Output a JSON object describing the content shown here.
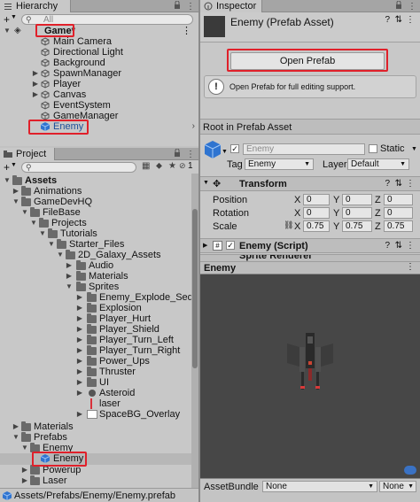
{
  "hierarchy": {
    "tab_label": "Hierarchy",
    "search_placeholder": "All",
    "add_button": "+",
    "items": [
      {
        "label": "Game*"
      },
      {
        "label": "Main Camera"
      },
      {
        "label": "Directional Light"
      },
      {
        "label": "Background"
      },
      {
        "label": "SpawnManager"
      },
      {
        "label": "Player"
      },
      {
        "label": "Canvas"
      },
      {
        "label": "EventSystem"
      },
      {
        "label": "GameManager"
      },
      {
        "label": "Enemy"
      }
    ]
  },
  "project": {
    "tab_label": "Project",
    "add_button": "+",
    "hidden_count": "1",
    "tree": [
      {
        "label": "Assets"
      },
      {
        "label": "Animations"
      },
      {
        "label": "GameDevHQ"
      },
      {
        "label": "FileBase"
      },
      {
        "label": "Projects"
      },
      {
        "label": "Tutorials"
      },
      {
        "label": "Starter_Files"
      },
      {
        "label": "2D_Galaxy_Assets"
      },
      {
        "label": "Audio"
      },
      {
        "label": "Materials"
      },
      {
        "label": "Sprites"
      },
      {
        "label": "Enemy_Explode_Sequen"
      },
      {
        "label": "Explosion"
      },
      {
        "label": "Player_Hurt"
      },
      {
        "label": "Player_Shield"
      },
      {
        "label": "Player_Turn_Left"
      },
      {
        "label": "Player_Turn_Right"
      },
      {
        "label": "Power_Ups"
      },
      {
        "label": "Thruster"
      },
      {
        "label": "UI"
      },
      {
        "label": "Asteroid"
      },
      {
        "label": "laser"
      },
      {
        "label": "SpaceBG_Overlay"
      },
      {
        "label": "Materials"
      },
      {
        "label": "Prefabs"
      },
      {
        "label": "Enemy"
      },
      {
        "label": "Enemy"
      },
      {
        "label": "Powerup"
      },
      {
        "label": "Laser"
      }
    ],
    "path": "Assets/Prefabs/Enemy/Enemy.prefab"
  },
  "inspector": {
    "tab_label": "Inspector",
    "title": "Enemy (Prefab Asset)",
    "open_prefab_label": "Open Prefab",
    "info_text": "Open Prefab for full editing support.",
    "root_label": "Root in Prefab Asset",
    "object_name": "Enemy",
    "static_label": "Static",
    "tag_label": "Tag",
    "tag_value": "Enemy",
    "layer_label": "Layer",
    "layer_value": "Default",
    "transform": {
      "title": "Transform",
      "rows": [
        {
          "label": "Position",
          "x": "0",
          "y": "0",
          "z": "0"
        },
        {
          "label": "Rotation",
          "x": "0",
          "y": "0",
          "z": "0"
        },
        {
          "label": "Scale",
          "x": "0.75",
          "y": "0.75",
          "z": "0.75"
        }
      ],
      "axis_x": "X",
      "axis_y": "Y",
      "axis_z": "Z"
    },
    "script_component": "Enemy (Script)",
    "sprite_component": "Sprite Renderer",
    "preview_title": "Enemy",
    "assetbundle_label": "AssetBundle",
    "assetbundle_value": "None",
    "assetbundle_variant": "None"
  },
  "colors": {
    "highlight_red": "#e0202a",
    "selection_blue": "#3a72c4",
    "preview_bg": "#474747"
  }
}
